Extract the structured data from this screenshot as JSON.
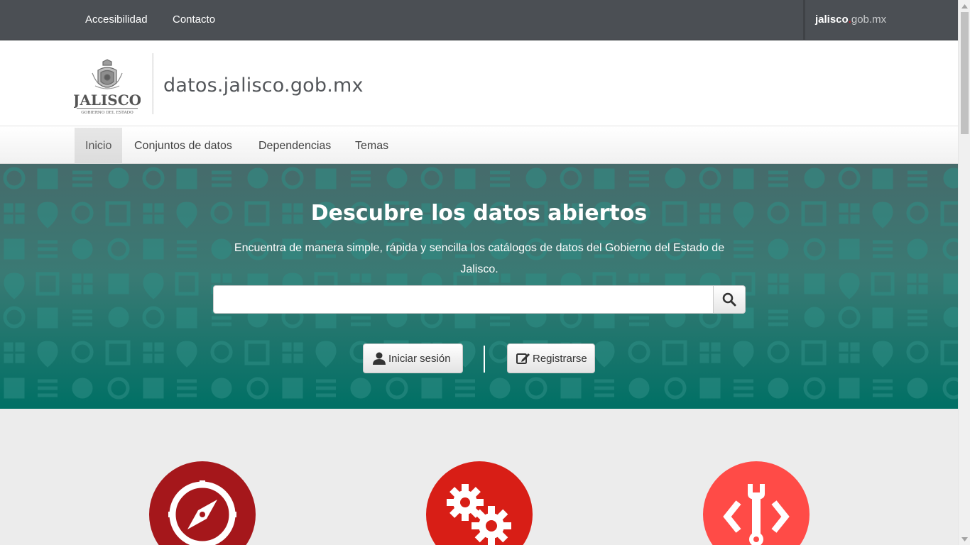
{
  "topbar": {
    "links": [
      "Accesibilidad",
      "Contacto"
    ],
    "brand_bold": "jalisco",
    "brand_dot": ".",
    "brand_rest": "gob.mx"
  },
  "header": {
    "logo_text": "JALISCO",
    "logo_subtext": "GOBIERNO DEL ESTADO",
    "site_title": "datos.jalisco.gob.mx"
  },
  "nav": {
    "items": [
      "Inicio",
      "Conjuntos de datos",
      "Dependencias",
      "Temas"
    ],
    "active": "Inicio"
  },
  "hero": {
    "title": "Descubre los datos abiertos",
    "subtitle": "Encuentra de manera simple, rápida y sencilla los catálogos de datos del Gobierno del Estado de Jalisco.",
    "search_value": "",
    "login_label": "Iniciar sesión",
    "register_label": "Registrarse"
  },
  "features": {
    "icons": [
      "compass-icon",
      "gears-icon",
      "code-wrench-icon"
    ],
    "colors": [
      "#a5171b",
      "#d81e16",
      "#ff4b47"
    ]
  },
  "colors": {
    "topbar": "#4b4f54",
    "hero_top": "#466b6b",
    "hero_bottom": "#007065",
    "brand_dot": "#c2242e"
  }
}
